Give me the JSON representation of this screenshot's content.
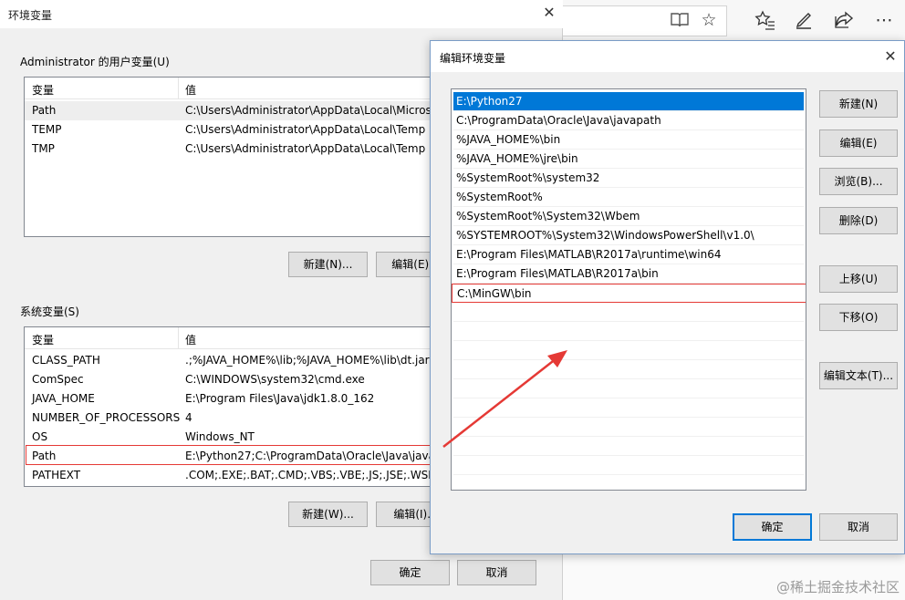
{
  "env_dialog": {
    "title": "环境变量",
    "user_group_label": "Administrator 的用户变量(U)",
    "user_vars": {
      "headers": [
        "变量",
        "值"
      ],
      "rows": [
        {
          "name": "Path",
          "value": "C:\\Users\\Administrator\\AppData\\Local\\Micros"
        },
        {
          "name": "TEMP",
          "value": "C:\\Users\\Administrator\\AppData\\Local\\Temp"
        },
        {
          "name": "TMP",
          "value": "C:\\Users\\Administrator\\AppData\\Local\\Temp"
        }
      ]
    },
    "user_buttons": {
      "new": "新建(N)...",
      "edit": "编辑(E)..."
    },
    "system_group_label": "系统变量(S)",
    "system_vars": {
      "headers": [
        "变量",
        "值"
      ],
      "rows": [
        {
          "name": "CLASS_PATH",
          "value": ".;%JAVA_HOME%\\lib;%JAVA_HOME%\\lib\\dt.jar"
        },
        {
          "name": "ComSpec",
          "value": "C:\\WINDOWS\\system32\\cmd.exe"
        },
        {
          "name": "JAVA_HOME",
          "value": "E:\\Program Files\\Java\\jdk1.8.0_162"
        },
        {
          "name": "NUMBER_OF_PROCESSORS",
          "value": "4"
        },
        {
          "name": "OS",
          "value": "Windows_NT"
        },
        {
          "name": "Path",
          "value": "E:\\Python27;C:\\ProgramData\\Oracle\\Java\\javap"
        },
        {
          "name": "PATHEXT",
          "value": ".COM;.EXE;.BAT;.CMD;.VBS;.VBE;.JS;.JSE;.WSF;.W"
        }
      ]
    },
    "system_buttons": {
      "new": "新建(W)...",
      "edit": "编辑(I)..."
    },
    "ok": "确定",
    "cancel": "取消"
  },
  "edit_dialog": {
    "title": "编辑环境变量",
    "entries": [
      "E:\\Python27",
      "C:\\ProgramData\\Oracle\\Java\\javapath",
      "%JAVA_HOME%\\bin",
      "%JAVA_HOME%\\jre\\bin",
      "%SystemRoot%\\system32",
      "%SystemRoot%",
      "%SystemRoot%\\System32\\Wbem",
      "%SYSTEMROOT%\\System32\\WindowsPowerShell\\v1.0\\",
      "E:\\Program Files\\MATLAB\\R2017a\\runtime\\win64",
      "E:\\Program Files\\MATLAB\\R2017a\\bin",
      "C:\\MinGW\\bin"
    ],
    "buttons": {
      "new": "新建(N)",
      "edit": "编辑(E)",
      "browse": "浏览(B)...",
      "delete": "删除(D)",
      "up": "上移(U)",
      "down": "下移(O)",
      "edit_text": "编辑文本(T)..."
    },
    "ok": "确定",
    "cancel": "取消"
  },
  "browser_icons": [
    "reading-view-icon",
    "favorite-star-icon",
    "favorites-list-icon",
    "pen-icon",
    "share-icon",
    "more-icon"
  ],
  "watermark": "@稀土掘金技术社区",
  "colors": {
    "selection": "#0078d7",
    "annotation_red": "#e53935"
  }
}
